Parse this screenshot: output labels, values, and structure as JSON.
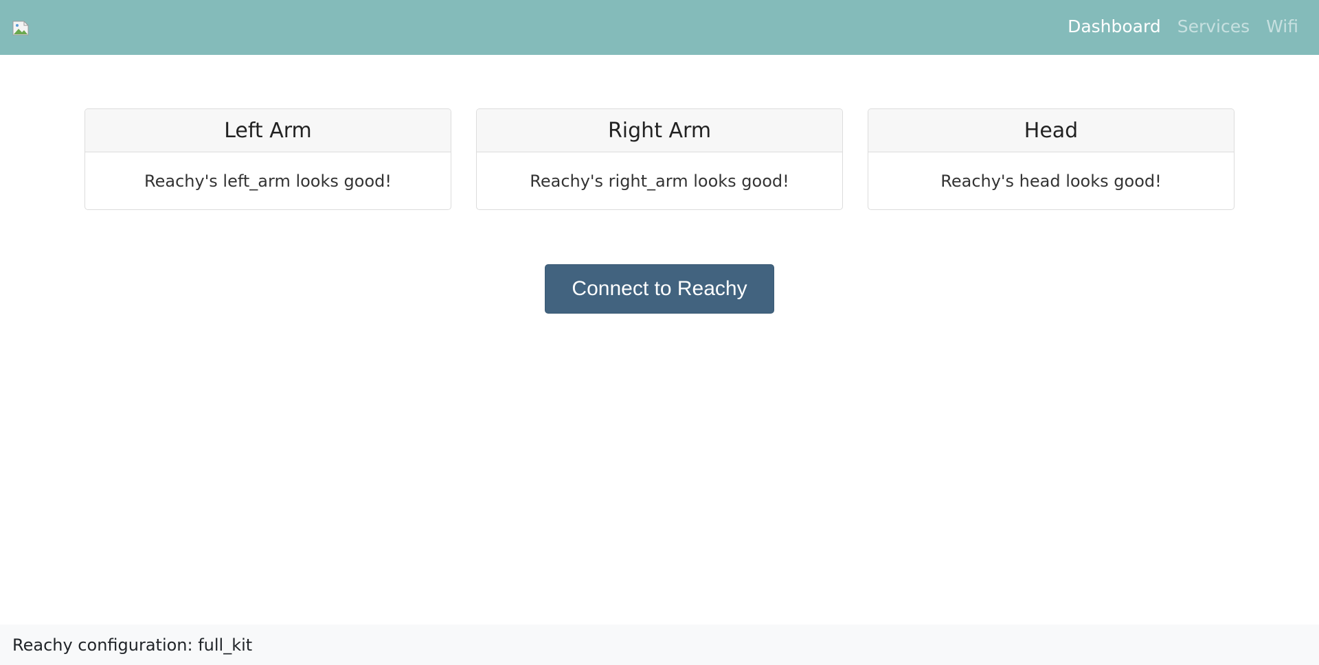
{
  "navbar": {
    "logo_icon": "broken-image-icon",
    "links": [
      {
        "label": "Dashboard",
        "active": true
      },
      {
        "label": "Services",
        "active": false
      },
      {
        "label": "Wifi",
        "active": false
      }
    ],
    "background": "#84bbba"
  },
  "cards": [
    {
      "title": "Left Arm",
      "status": "Reachy's left_arm looks good!"
    },
    {
      "title": "Right Arm",
      "status": "Reachy's right_arm looks good!"
    },
    {
      "title": "Head",
      "status": "Reachy's head looks good!"
    }
  ],
  "connect_button": {
    "label": "Connect to Reachy",
    "color": "#42637f"
  },
  "footer": {
    "text": "Reachy configuration: full_kit"
  }
}
